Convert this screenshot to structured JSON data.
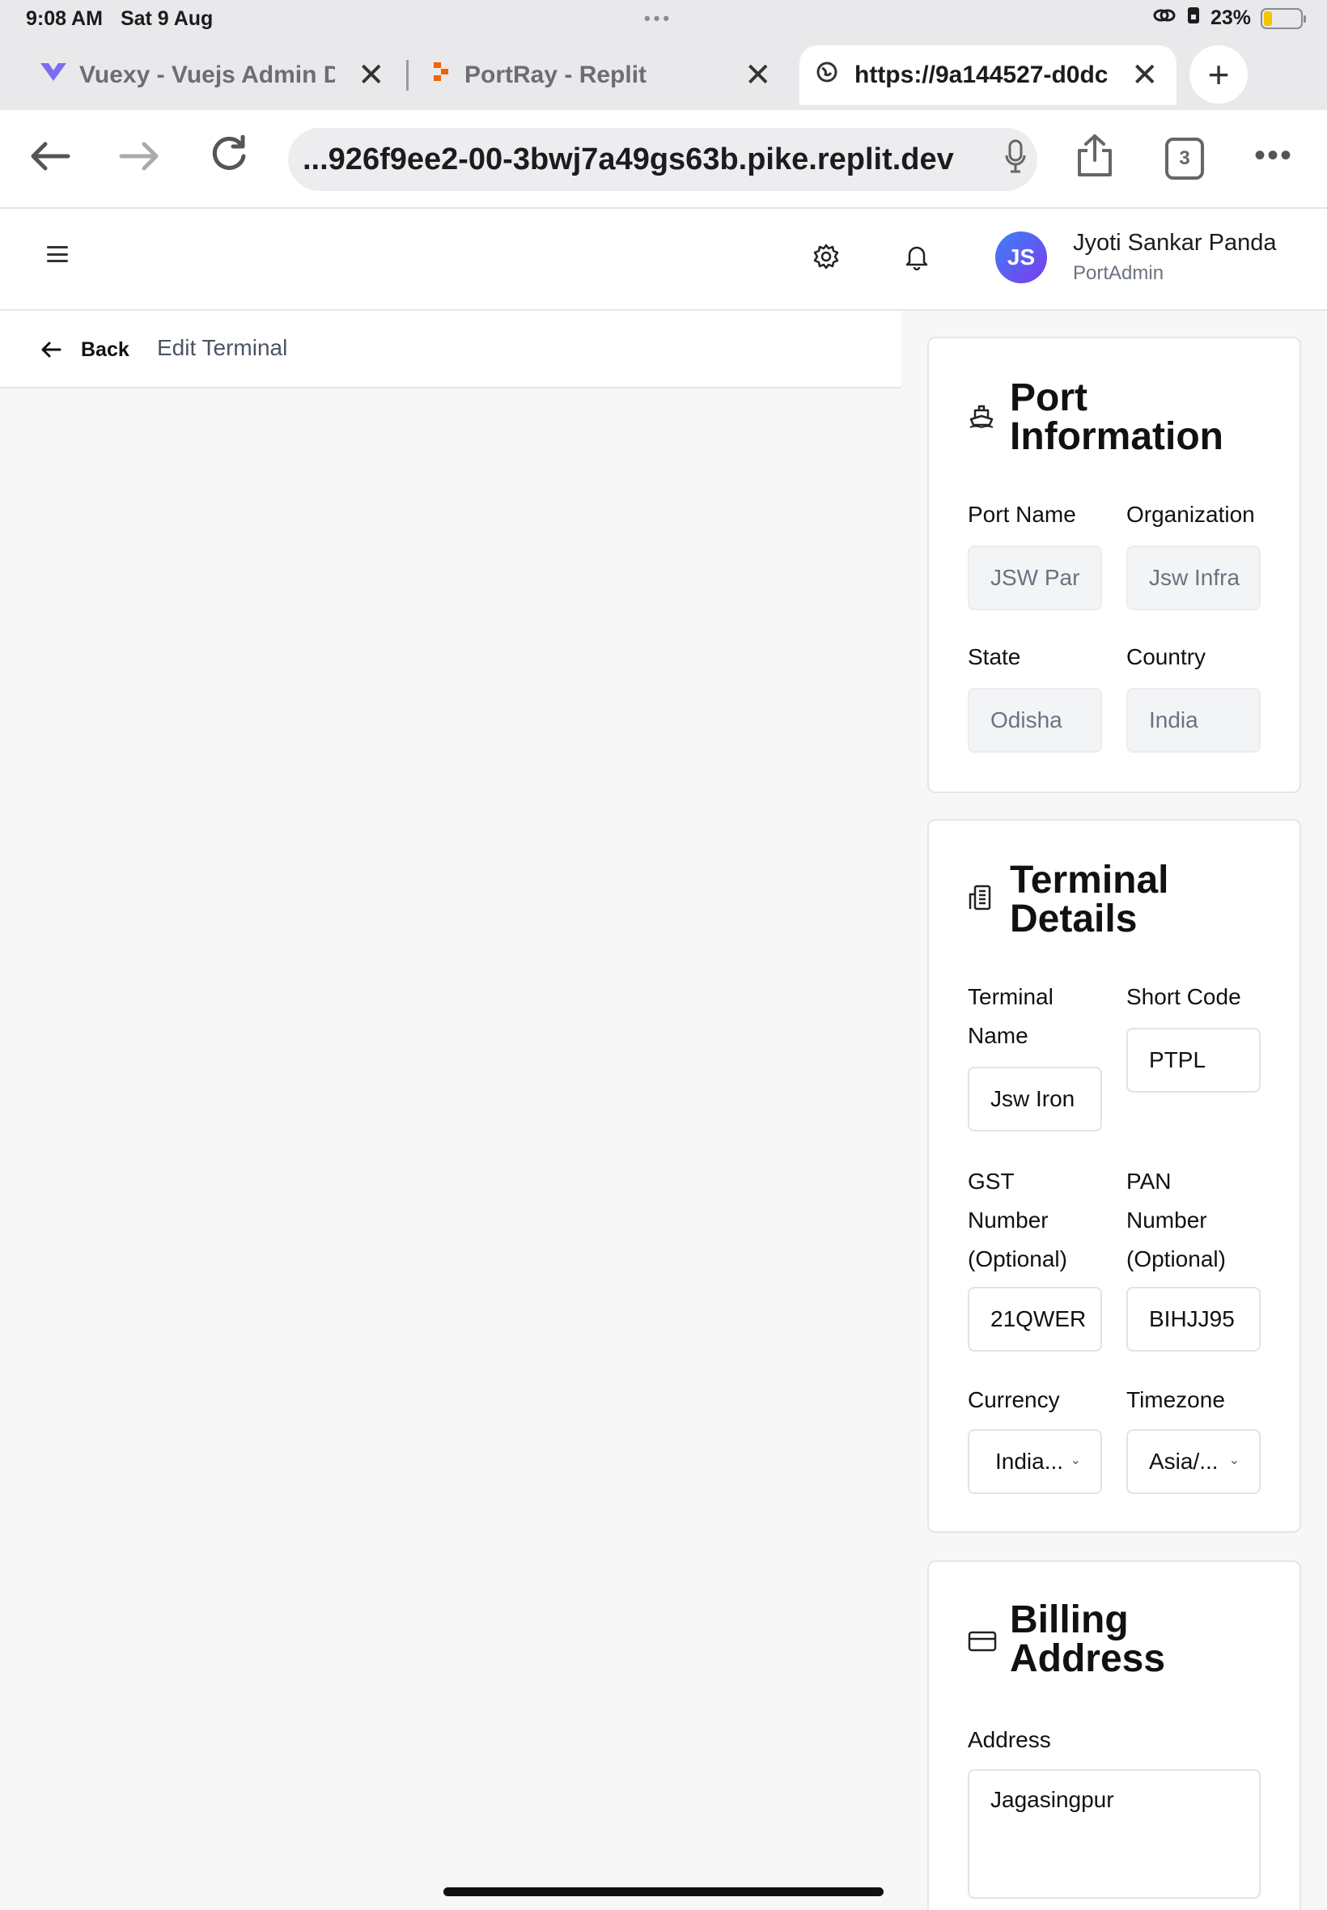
{
  "status": {
    "time": "9:08 AM",
    "date": "Sat 9 Aug",
    "battery": "23%",
    "battery_level": 0.23
  },
  "tabs": [
    {
      "label": "Vuexy - Vuejs Admin Da",
      "icon": "vuexy-logo-icon",
      "active": false
    },
    {
      "label": "PortRay - Replit",
      "icon": "replit-logo-icon",
      "active": false
    },
    {
      "label": "https://9a144527-d0dc",
      "icon": "globe-icon",
      "active": true
    }
  ],
  "browser": {
    "url": "...926f9ee2-00-3bwj7a49gs63b.pike.replit.dev",
    "tab_count": "3"
  },
  "header": {
    "user_initials": "JS",
    "user_name": "Jyoti Sankar Panda",
    "user_role": "PortAdmin"
  },
  "page": {
    "back_label": "Back",
    "title": "Edit Terminal"
  },
  "port_info": {
    "title_line1": "Port",
    "title_line2": "Information",
    "fields": {
      "port_name": {
        "label": "Port Name",
        "value": "JSW Par"
      },
      "organization": {
        "label": "Organization",
        "value": "Jsw Infra"
      },
      "state": {
        "label": "State",
        "value": "Odisha"
      },
      "country": {
        "label": "Country",
        "value": "India"
      }
    }
  },
  "terminal": {
    "title_line1": "Terminal",
    "title_line2": "Details",
    "fields": {
      "terminal_name": {
        "label_line1": "Terminal",
        "label_line2": "Name",
        "value": "Jsw Iron"
      },
      "short_code": {
        "label": "Short Code",
        "value": "PTPL"
      },
      "gst": {
        "label_line1": "GST",
        "label_line2": "Number",
        "label_line3": "(Optional)",
        "value": "21QWER"
      },
      "pan": {
        "label_line1": "PAN",
        "label_line2": "Number",
        "label_line3": "(Optional)",
        "value": "BIHJJ95"
      },
      "currency": {
        "label": "Currency",
        "value": "India..."
      },
      "timezone": {
        "label": "Timezone",
        "value": "Asia/..."
      }
    }
  },
  "billing": {
    "title_line1": "Billing",
    "title_line2": "Address",
    "fields": {
      "address": {
        "label": "Address",
        "value": "Jagasingpur"
      }
    }
  }
}
